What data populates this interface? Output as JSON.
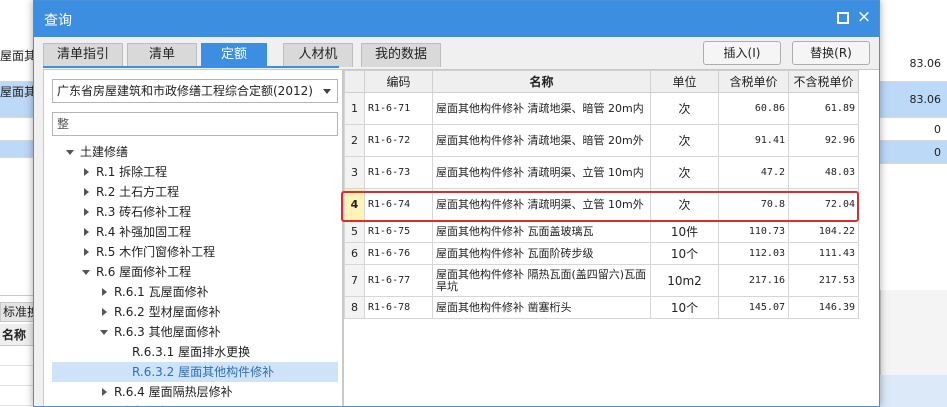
{
  "background": {
    "left_rows": [
      "屋面其他构件修补 清疏地渠 外",
      "屋面其他构件修补 外"
    ],
    "right_values": [
      "83.06",
      "83.06",
      "0",
      "0"
    ],
    "left_tab": "标准换算",
    "left_header": "名称"
  },
  "dialog": {
    "title": "查询",
    "tabs": [
      "清单指引",
      "清单",
      "定额",
      "人材机",
      "我的数据"
    ],
    "active_tab": "定额",
    "buttons": {
      "insert": "插入(I)",
      "replace": "替换(R)"
    },
    "close_icon": "×"
  },
  "left_panel": {
    "quota_library": "广东省房屋建筑和市政修缮工程综合定额(2012)",
    "filter_value": "整",
    "tree": [
      {
        "label": "土建修缮",
        "level": 0,
        "expanded": true
      },
      {
        "label": "R.1 拆除工程",
        "level": 1,
        "expanded": false
      },
      {
        "label": "R.2 土石方工程",
        "level": 1,
        "expanded": false
      },
      {
        "label": "R.3 砖石修补工程",
        "level": 1,
        "expanded": false
      },
      {
        "label": "R.4 补强加固工程",
        "level": 1,
        "expanded": false
      },
      {
        "label": "R.5 木作门窗修补工程",
        "level": 1,
        "expanded": false
      },
      {
        "label": "R.6 屋面修补工程",
        "level": 1,
        "expanded": true
      },
      {
        "label": "R.6.1 瓦屋面修补",
        "level": 2,
        "expanded": false
      },
      {
        "label": "R.6.2 型材屋面修补",
        "level": 2,
        "expanded": false
      },
      {
        "label": "R.6.3 其他屋面修补",
        "level": 2,
        "expanded": true
      },
      {
        "label": "R.6.3.1 屋面排水更换",
        "level": 3,
        "expanded": false
      },
      {
        "label": "R.6.3.2 屋面其他构件修补",
        "level": 3,
        "expanded": false,
        "selected": true
      },
      {
        "label": "R.6.4 屋面隔热层修补",
        "level": 2,
        "expanded": false
      },
      {
        "label": "R.7 防水修补工程",
        "level": 1,
        "expanded": false
      }
    ]
  },
  "grid": {
    "columns": [
      "",
      "编码",
      "名称",
      "单位",
      "含税单价",
      "不含税单价"
    ],
    "rows": [
      {
        "idx": "1",
        "code": "R1-6-71",
        "name": "屋面其他构件修补 清疏地渠、暗管 20m内",
        "unit": "次",
        "price_tax": "60.86",
        "price_notax": "61.89"
      },
      {
        "idx": "2",
        "code": "R1-6-72",
        "name": "屋面其他构件修补 清疏地渠、暗管 20m外",
        "unit": "次",
        "price_tax": "91.41",
        "price_notax": "92.96"
      },
      {
        "idx": "3",
        "code": "R1-6-73",
        "name": "屋面其他构件修补 清疏明渠、立管 10m内",
        "unit": "次",
        "price_tax": "47.2",
        "price_notax": "48.03"
      },
      {
        "idx": "4",
        "code": "R1-6-74",
        "name": "屋面其他构件修补 清疏明渠、立管 10m外",
        "unit": "次",
        "price_tax": "70.8",
        "price_notax": "72.04",
        "current": true
      },
      {
        "idx": "5",
        "code": "R1-6-75",
        "name": "屋面其他构件修补 瓦面盖玻璃瓦",
        "unit": "10件",
        "price_tax": "110.73",
        "price_notax": "104.22"
      },
      {
        "idx": "6",
        "code": "R1-6-76",
        "name": "屋面其他构件修补 瓦面阶砖步级",
        "unit": "10个",
        "price_tax": "112.03",
        "price_notax": "111.43"
      },
      {
        "idx": "7",
        "code": "R1-6-77",
        "name": "屋面其他构件修补 隔热瓦面(盖四留六)瓦面旱坑",
        "unit": "10m2",
        "price_tax": "217.16",
        "price_notax": "217.53"
      },
      {
        "idx": "8",
        "code": "R1-6-78",
        "name": "屋面其他构件修补 凿塞桁头",
        "unit": "10个",
        "price_tax": "145.07",
        "price_notax": "146.39"
      }
    ]
  }
}
